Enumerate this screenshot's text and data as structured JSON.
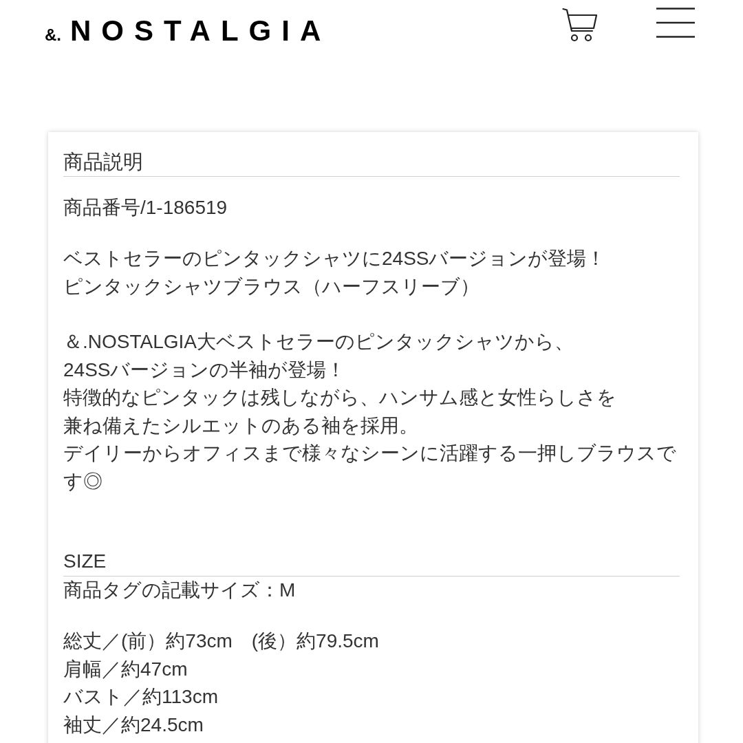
{
  "header": {
    "logo_prefix": "&.",
    "logo_name": "NOSTALGIA"
  },
  "description": {
    "heading": "商品説明",
    "product_number": "商品番号/1-186519",
    "paragraphs": [
      [
        "ベストセラーのピンタックシャツに24SSバージョンが登場！",
        "ピンタックシャツブラウス（ハーフスリーブ）"
      ],
      [
        "＆.NOSTALGIA大ベストセラーのピンタックシャツから、",
        "24SSバージョンの半袖が登場！",
        "特徴的なピンタックは残しながら、ハンサム感と女性らしさを",
        "兼ね備えたシルエットのある袖を採用。",
        "デイリーからオフィスまで様々なシーンに活躍する一押しブラウスです◎"
      ]
    ]
  },
  "size": {
    "heading": "SIZE",
    "tag_size": "商品タグの記載サイズ：M",
    "measurements": [
      "総丈／(前）約73cm　(後）約79.5cm",
      "肩幅／約47cm",
      "バスト／約113cm",
      "袖丈／約24.5cm"
    ]
  }
}
